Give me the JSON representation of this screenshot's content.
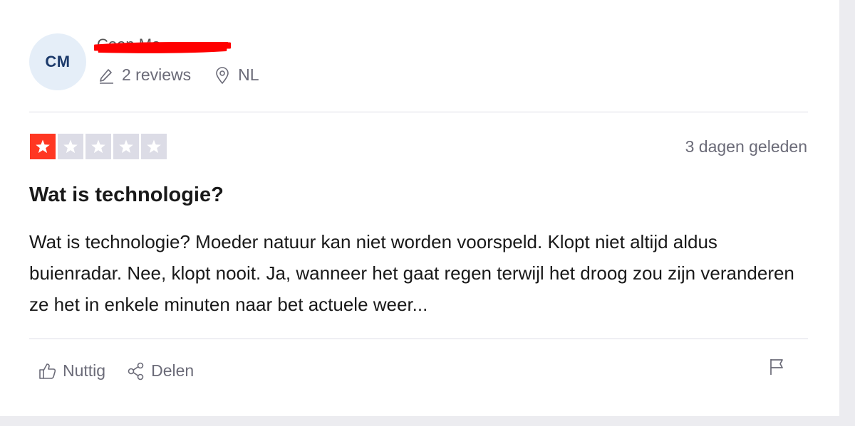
{
  "reviewer": {
    "initials": "CM",
    "name": "Coen Mo",
    "reviews": "2 reviews",
    "country": "NL"
  },
  "review": {
    "rating": 1,
    "max_rating": 5,
    "date": "3 dagen geleden",
    "title": "Wat is technologie?",
    "body": "Wat is technologie? Moeder natuur kan niet worden voorspeld. Klopt niet altijd aldus buienradar. Nee, klopt nooit. Ja, wanneer het gaat regen terwijl het droog zou zijn veranderen ze het in enkele minuten naar bet actuele weer..."
  },
  "actions": {
    "useful_label": "Nuttig",
    "share_label": "Delen"
  },
  "icons": {
    "pencil": "pencil-icon",
    "location": "location-pin-icon",
    "thumbs_up": "thumbs-up-icon",
    "share": "share-icon",
    "flag": "flag-icon"
  },
  "colors": {
    "star_active": "#ff3722",
    "star_inactive": "#dcdce6",
    "redaction": "#ff0000",
    "avatar_bg": "#e5eef8",
    "avatar_text": "#1c3a6b"
  }
}
